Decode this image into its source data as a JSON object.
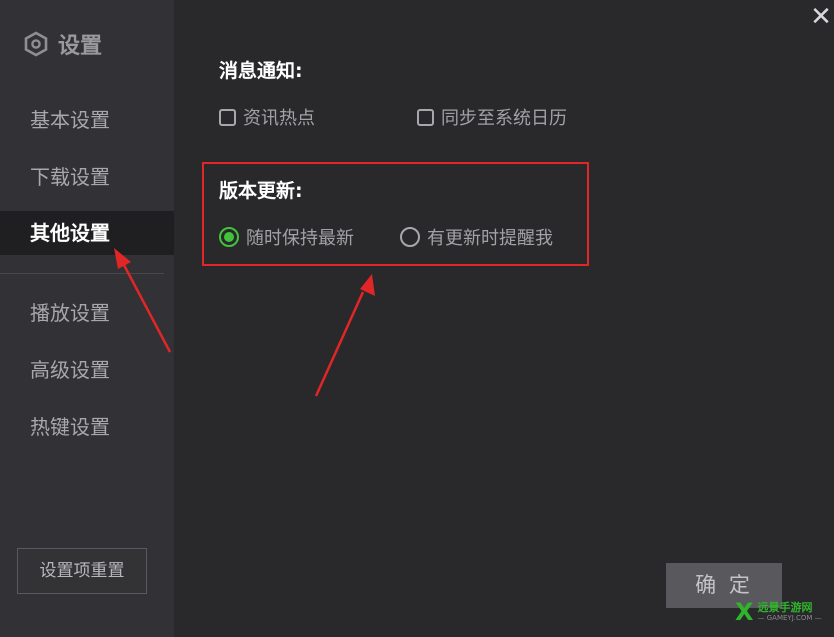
{
  "window": {
    "title": "设置",
    "close_glyph": "✕"
  },
  "sidebar": {
    "items": [
      {
        "label": "基本设置"
      },
      {
        "label": "下载设置"
      },
      {
        "label": "其他设置"
      },
      {
        "label": "播放设置"
      },
      {
        "label": "高级设置"
      },
      {
        "label": "热键设置"
      }
    ],
    "active_item": "其他设置",
    "reset_label": "设置项重置"
  },
  "notifications": {
    "title": "消息通知:",
    "options": [
      {
        "label": "资讯热点",
        "checked": false
      },
      {
        "label": "同步至系统日历",
        "checked": false
      }
    ]
  },
  "updates": {
    "title": "版本更新:",
    "options": [
      {
        "label": "随时保持最新",
        "selected": true
      },
      {
        "label": "有更新时提醒我",
        "selected": false
      }
    ]
  },
  "confirm_label": "确 定",
  "watermark": {
    "brand": "远景手游网",
    "url": "— GAMEYJ.COM —"
  },
  "colors": {
    "accent_green": "#43c23b",
    "highlight_red": "#e02626",
    "sidebar_bg": "#323236",
    "main_bg": "#29292c"
  }
}
